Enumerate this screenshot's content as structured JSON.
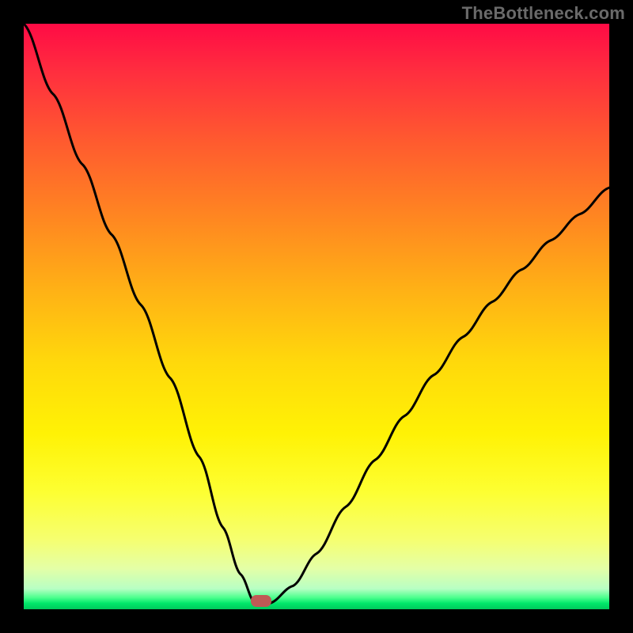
{
  "watermark": "TheBottleneck.com",
  "marker": {
    "x_frac": 0.405,
    "y_frac": 0.985
  },
  "chart_data": {
    "type": "line",
    "title": "",
    "xlabel": "",
    "ylabel": "",
    "xlim": [
      0,
      1
    ],
    "ylim": [
      0,
      1
    ],
    "grid": false,
    "legend": false,
    "series": [
      {
        "name": "bottleneck-curve",
        "x": [
          0.0,
          0.05,
          0.1,
          0.15,
          0.2,
          0.25,
          0.3,
          0.34,
          0.37,
          0.395,
          0.42,
          0.46,
          0.5,
          0.55,
          0.6,
          0.65,
          0.7,
          0.75,
          0.8,
          0.85,
          0.9,
          0.95,
          1.0
        ],
        "y": [
          1.0,
          0.88,
          0.76,
          0.64,
          0.52,
          0.395,
          0.26,
          0.14,
          0.06,
          0.01,
          0.01,
          0.04,
          0.095,
          0.175,
          0.255,
          0.33,
          0.4,
          0.465,
          0.525,
          0.58,
          0.63,
          0.675,
          0.72
        ]
      }
    ],
    "annotations": [
      {
        "type": "marker",
        "shape": "rounded-rect",
        "color": "#c05a55",
        "x": 0.405,
        "y": 0.015
      }
    ],
    "background_gradient": {
      "direction": "vertical",
      "stops": [
        {
          "pos": 0.0,
          "color": "#ff0b45"
        },
        {
          "pos": 0.5,
          "color": "#ffc010"
        },
        {
          "pos": 0.8,
          "color": "#fdff32"
        },
        {
          "pos": 1.0,
          "color": "#00c95c"
        }
      ]
    }
  }
}
